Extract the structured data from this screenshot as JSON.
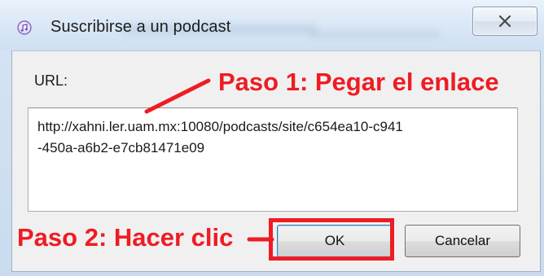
{
  "window": {
    "title": "Suscribirse a un podcast",
    "icon": "itunes-icon",
    "close_icon": "close-icon"
  },
  "form": {
    "url_label": "URL:",
    "url_value": "http://xahni.ler.uam.mx:10080/podcasts/site/c654ea10-c941\n-450a-a6b2-e7cb81471e09"
  },
  "buttons": {
    "ok_label": "OK",
    "cancel_label": "Cancelar"
  },
  "annotations": {
    "step1": "Paso 1: Pegar el enlace",
    "step2": "Paso 2: Hacer clic",
    "color": "#ee1c24"
  }
}
